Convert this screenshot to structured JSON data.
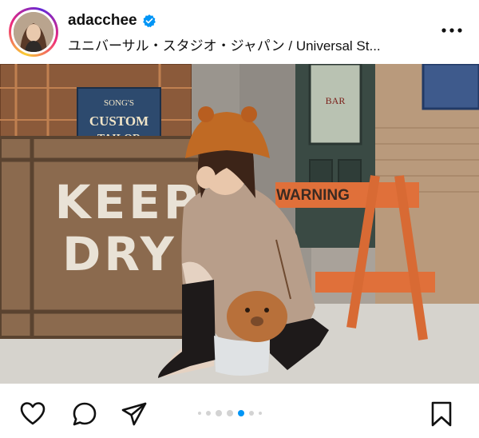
{
  "post": {
    "username": "adacchee",
    "location": "ユニバーサル・スタジオ・ジャパン / Universal St...",
    "verified": true,
    "accent_color": "#0095f6"
  },
  "photo": {
    "signs": {
      "keep_dry_line1": "KEEP",
      "keep_dry_line2": "DRY",
      "custom_tailor_top": "SONG'S",
      "custom_tailor_mid": "CUSTOM",
      "custom_tailor_bottom": "TAILOR",
      "warning": "WARNING",
      "bar": "BAR"
    }
  },
  "carousel": {
    "total": 7,
    "active_index": 4
  },
  "icons": [
    "heart-icon",
    "comment-icon",
    "share-icon",
    "bookmark-icon",
    "more-icon",
    "verified-icon"
  ]
}
